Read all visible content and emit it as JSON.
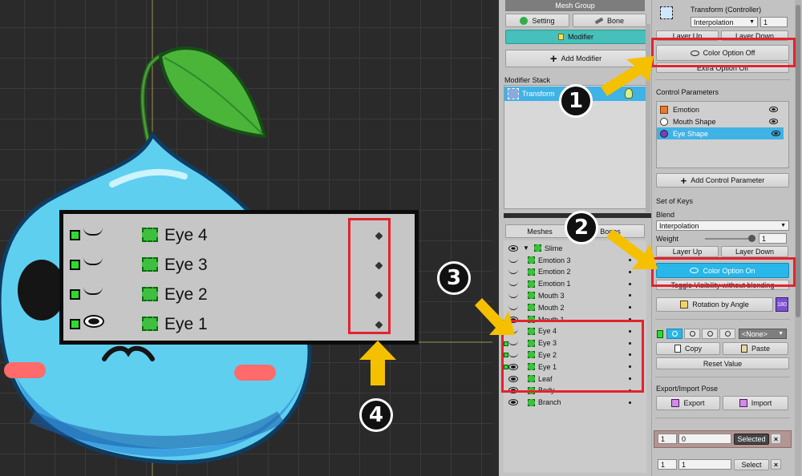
{
  "zoom_overlay": {
    "rows": [
      {
        "label": "Eye 4",
        "icon": "closed-eye-icon"
      },
      {
        "label": "Eye 3",
        "icon": "closed-eye-icon"
      },
      {
        "label": "Eye 2",
        "icon": "closed-eye-icon"
      },
      {
        "label": "Eye 1",
        "icon": "open-eye-icon"
      }
    ]
  },
  "badges": {
    "b1": "1",
    "b2": "2",
    "b3": "3",
    "b4": "4"
  },
  "mid": {
    "header": "Mesh Group",
    "setting": "Setting",
    "bone": "Bone",
    "modifier": "Modifier",
    "add_modifier": "Add Modifier",
    "modifier_stack": "Modifier Stack",
    "stack_item": "Transform",
    "tab_meshes": "Meshes",
    "tab_bones": "Bones",
    "root": "Slime",
    "tree": [
      {
        "label": "Emotion 3",
        "icon": "closed"
      },
      {
        "label": "Emotion 2",
        "icon": "closed"
      },
      {
        "label": "Emotion 1",
        "icon": "closed"
      },
      {
        "label": "Mouth 3",
        "icon": "closed"
      },
      {
        "label": "Mouth 2",
        "icon": "closed"
      },
      {
        "label": "Mouth 1",
        "icon": "open"
      },
      {
        "label": "Eye 4",
        "icon": "closed"
      },
      {
        "label": "Eye 3",
        "icon": "closed"
      },
      {
        "label": "Eye 2",
        "icon": "closed"
      },
      {
        "label": "Eye 1",
        "icon": "open"
      },
      {
        "label": "Leaf",
        "icon": "open"
      },
      {
        "label": "Body",
        "icon": "open"
      },
      {
        "label": "Branch",
        "icon": "open"
      }
    ]
  },
  "right": {
    "title": "Transform (Controller)",
    "interp_value": "Interpolation",
    "interp_num": "1",
    "layer_up_top": "Layer Up",
    "layer_down_top": "Layer Down",
    "color_off": "Color Option Off",
    "extra_off": "Extra Option Off",
    "control_params": "Control Parameters",
    "params": [
      "Emotion",
      "Mouth Shape",
      "Eye Shape"
    ],
    "add_param": "Add Control Parameter",
    "set_of_keys": "Set of Keys",
    "blend": "Blend",
    "blend_value": "Interpolation",
    "weight": "Weight",
    "weight_value": "1",
    "weight_fraction": 1.0,
    "layer_up": "Layer Up",
    "layer_down": "Layer Down",
    "color_on": "Color Option On",
    "toggle_vis": "Toggle Visibility without blending",
    "rotation": "Rotation by Angle",
    "rotation_badge": "180",
    "none_select": "<None>",
    "copy": "Copy",
    "paste": "Paste",
    "reset": "Reset Value",
    "export_import": "Export/Import Pose",
    "export": "Export",
    "import": "Import",
    "sel_a": "1",
    "sel_b": "0",
    "selected": "Selected",
    "sel_c": "1",
    "sel_d": "1",
    "select": "Select",
    "x": "×"
  },
  "colors": {
    "accent": "#29b6e8",
    "teal": "#47bfba",
    "highlight": "#3fb2e6",
    "red": "#e3232e",
    "arrow": "#f5c000"
  }
}
